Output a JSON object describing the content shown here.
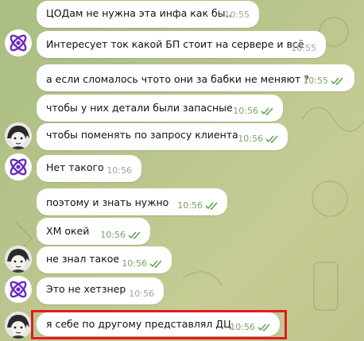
{
  "messages": [
    {
      "text": "ЦОДам не нужна эта инфа как бы..",
      "time": "10:55",
      "sender": "other",
      "read": false
    },
    {
      "text": "Интересует ток какой БП стоит на сервере и всё",
      "time": "10:55",
      "sender": "other",
      "read": false
    },
    {
      "text": "а если сломалось чтото они за бабки не меняют ?",
      "time": "10:55",
      "sender": "me",
      "read": true
    },
    {
      "text": "чтобы у них детали были запасные",
      "time": "10:56",
      "sender": "me",
      "read": true
    },
    {
      "text": "чтобы поменять по запросу клиента",
      "time": "10:56",
      "sender": "me",
      "read": true
    },
    {
      "text": "Нет такого",
      "time": "10:56",
      "sender": "other",
      "read": false
    },
    {
      "text": "поэтому и знать нужно",
      "time": "10:56",
      "sender": "me",
      "read": true
    },
    {
      "text": "ХМ окей",
      "time": "10:56",
      "sender": "me",
      "read": true
    },
    {
      "text": "не знал такое",
      "time": "10:56",
      "sender": "me",
      "read": true
    },
    {
      "text": "Это не хетзнер",
      "time": "10:56",
      "sender": "other",
      "read": false
    },
    {
      "text": "я себе по другому представлял ДЦ",
      "time": "10:56",
      "sender": "me",
      "read": true
    }
  ],
  "avatars": {
    "other": "purple-atom-avatar",
    "me": "anime-character-avatar"
  },
  "colors": {
    "bubble": "#ffffff",
    "time_outgoing": "#7aa36a",
    "time_incoming": "#9aa79a",
    "checkmarks": "#5fa84f",
    "highlight_border": "#e11b22",
    "avatar_purple": "#6a2bbf"
  },
  "highlight": {
    "target_message_index": 10
  }
}
